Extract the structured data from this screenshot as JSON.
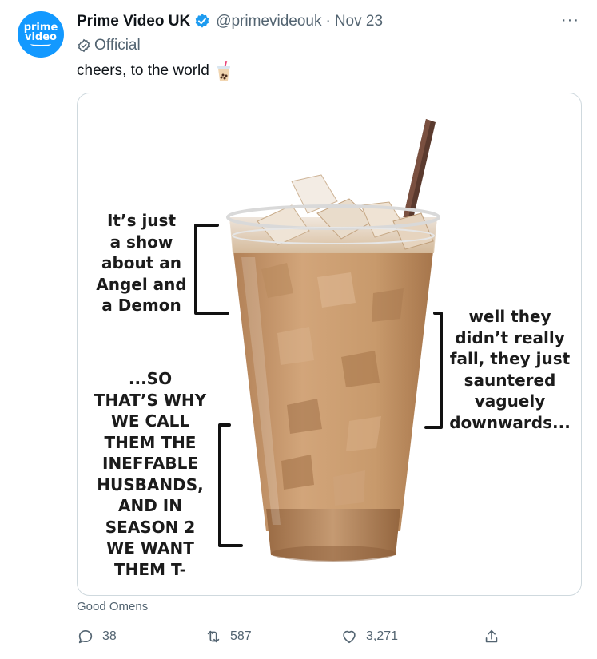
{
  "tweet": {
    "avatar_text": "prime\nvideo",
    "display_name": "Prime Video UK",
    "handle": "@primevideouk",
    "separator": "·",
    "date": "Nov 23",
    "label": "Official",
    "text": "cheers, to the world",
    "more_label": "···",
    "source": "Good Omens"
  },
  "meme": {
    "left_top": "It’s just\na show\nabout an\nAngel and\na Demon",
    "left_bottom": "...SO\nTHAT’S WHY\nWE CALL\nTHEM THE\nINEFFABLE\nHUSBANDS,\nAND IN\nSEASON 2\nWE WANT\nTHEM T-",
    "right": "well they\ndidn’t really\nfall, they just\nsauntered\nvaguely\ndownwards..."
  },
  "actions": {
    "reply_count": "38",
    "retweet_count": "587",
    "like_count": "3,271"
  },
  "colors": {
    "brand_blue": "#1d9bf0",
    "avatar_blue": "#1399ff",
    "muted_text": "#536471",
    "coffee": "#c89a6c"
  },
  "icons": [
    "verified-badge-icon",
    "official-badge-icon",
    "bubble-tea-icon",
    "more-icon",
    "reply-icon",
    "retweet-icon",
    "like-icon",
    "share-icon"
  ]
}
